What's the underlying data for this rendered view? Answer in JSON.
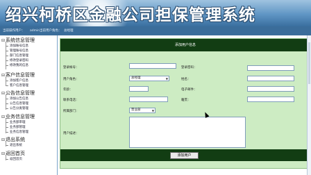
{
  "app": {
    "title": "绍兴柯桥区金融公司担保管理系统"
  },
  "userbar": {
    "current_user_label": "当前操作用户：",
    "current_user": "admin",
    "role_label": "当前用户角色：",
    "role": "总经理"
  },
  "sidebar": {
    "groups": [
      {
        "label": "系统信息管理",
        "items": [
          "添加账号信息",
          "管理账号信息",
          "部门信息管理",
          "修改登录密码",
          "修改我的信息"
        ]
      },
      {
        "label": "客户信息管理",
        "items": [
          "添加客户信息",
          "客户信息管理"
        ]
      },
      {
        "label": "公告信息管理",
        "items": [
          "添加公告信息",
          "公告信息管理",
          "公告分类管理"
        ]
      },
      {
        "label": "业务信息管理",
        "items": [
          "业务部审理",
          "业务部管理",
          "业务信息管理"
        ]
      },
      {
        "label": "退出系统",
        "items": [
          "退出系统"
        ]
      },
      {
        "label": "返回首页",
        "items": [
          "返回首页"
        ]
      }
    ]
  },
  "form": {
    "title": "添加用户信息",
    "login_account_label": "登录帐号：",
    "login_password_label": "登录密码：",
    "role_label": "用户角色：",
    "role_value": "总经理",
    "name_label": "姓名：",
    "age_label": "年龄：",
    "email_label": "电子邮件：",
    "phone_label": "联系电话：",
    "address_label": "籍贯：",
    "dept_label": "所属部门：",
    "dept_value": "营业部",
    "desc_label": "用户描述：",
    "submit_label": "添加用户"
  }
}
